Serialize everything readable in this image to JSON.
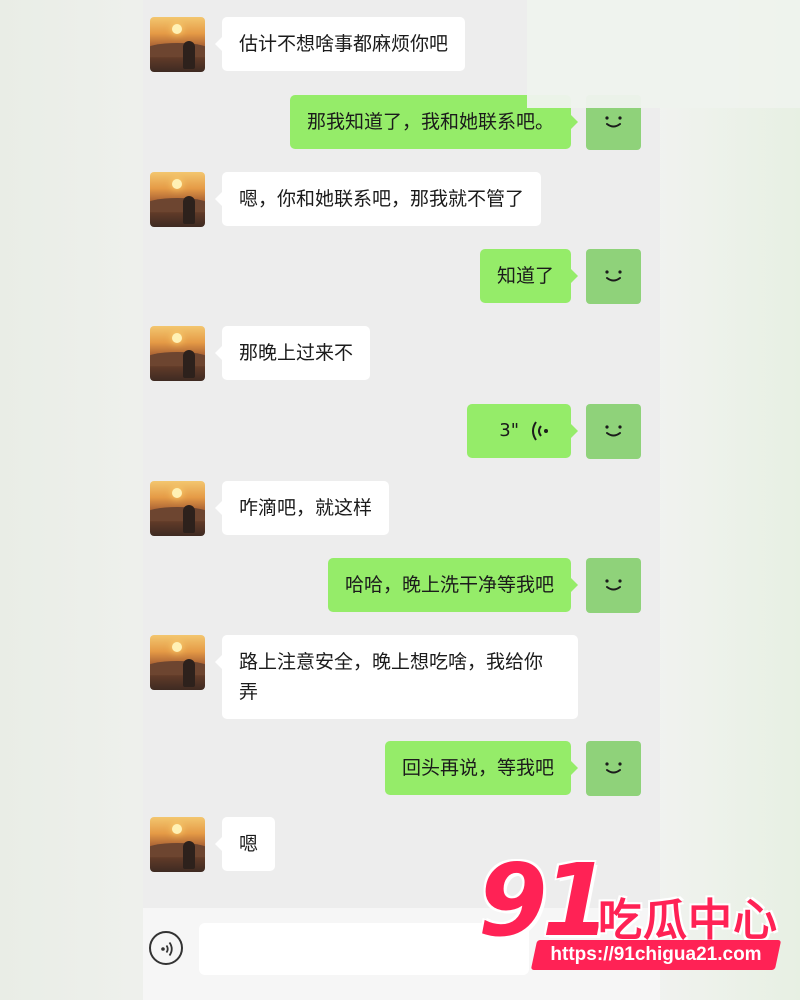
{
  "chat": {
    "messages": [
      {
        "side": "in",
        "text": "估计不想啥事都麻烦你吧"
      },
      {
        "side": "out",
        "text": "那我知道了，我和她联系吧。"
      },
      {
        "side": "in",
        "text": "嗯，你和她联系吧，那我就不管了"
      },
      {
        "side": "out",
        "text": "知道了"
      },
      {
        "side": "in",
        "text": "那晚上过来不"
      },
      {
        "side": "out",
        "type": "voice",
        "duration": "3\""
      },
      {
        "side": "in",
        "text": "咋滴吧，就这样"
      },
      {
        "side": "out",
        "text": "哈哈，晚上洗干净等我吧"
      },
      {
        "side": "in",
        "text": "路上注意安全，晚上想吃啥，我给你弄"
      },
      {
        "side": "out",
        "text": "回头再说，等我吧"
      },
      {
        "side": "in",
        "text": "嗯"
      }
    ]
  },
  "icons": {
    "contact_avatar": "sunset-avatar",
    "my_avatar": "smiley-avatar",
    "voice_message": "sound-wave-icon",
    "voice_toggle": "voice-input-icon"
  },
  "colors": {
    "incoming_bubble": "#ffffff",
    "outgoing_bubble": "#95ec69",
    "chat_background": "#ededed",
    "watermark": "#ff2255"
  },
  "watermark": {
    "number": "91",
    "name": "吃瓜中心",
    "url": "https://91chigua21.com"
  }
}
